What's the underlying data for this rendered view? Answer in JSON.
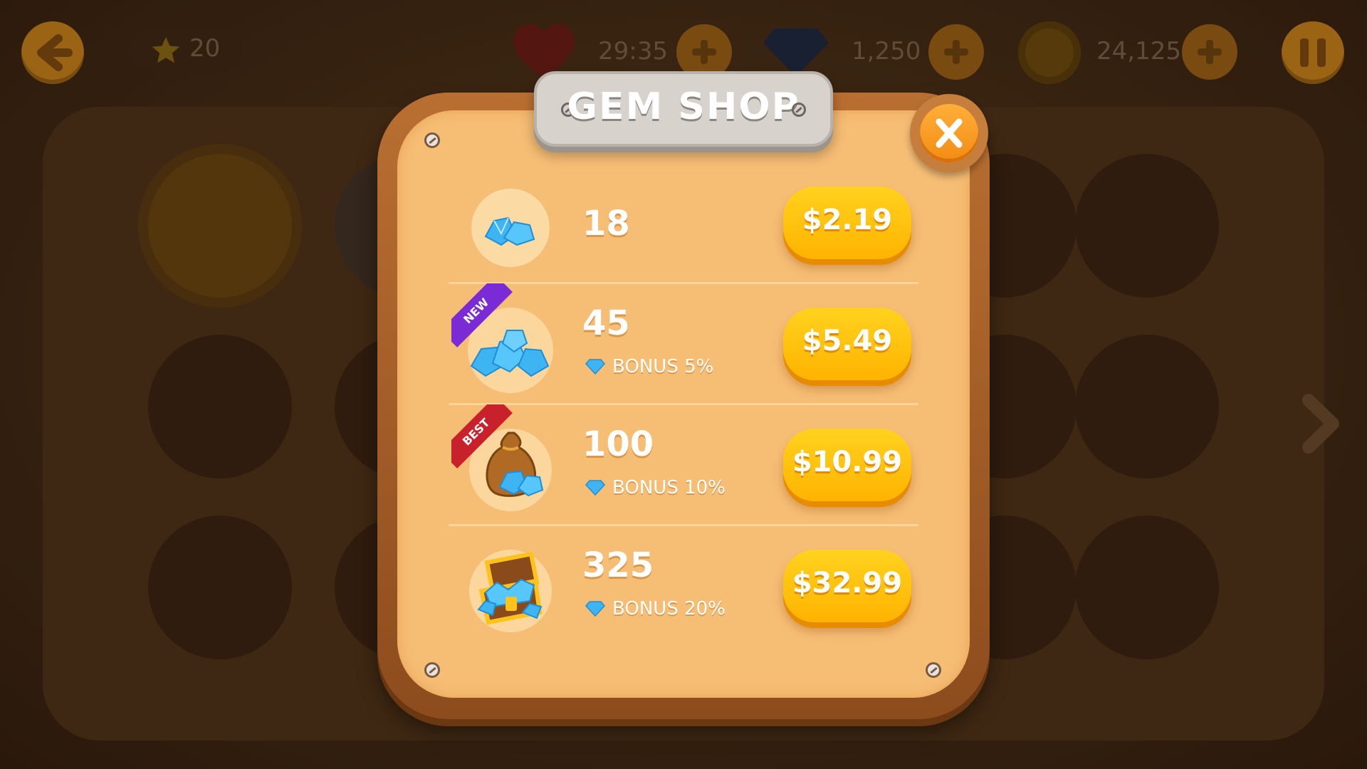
{
  "hud": {
    "stars": "20",
    "timer": "29:35",
    "gems": "1,250",
    "coins": "24,125"
  },
  "shop": {
    "title": "GEM SHOP",
    "packs": [
      {
        "amount": "18",
        "bonus": "",
        "price": "$2.19",
        "badge": "",
        "icon": "small-gem-pile-icon"
      },
      {
        "amount": "45",
        "bonus": "BONUS 5%",
        "price": "$5.49",
        "badge": "NEW",
        "icon": "gem-pile-icon"
      },
      {
        "amount": "100",
        "bonus": "BONUS 10%",
        "price": "$10.99",
        "badge": "BEST",
        "icon": "gem-sack-icon"
      },
      {
        "amount": "325",
        "bonus": "BONUS 20%",
        "price": "$32.99",
        "badge": "",
        "icon": "treasure-chest-icon"
      }
    ]
  },
  "colors": {
    "panel": "#f6bd75",
    "frame": "#a65e27",
    "button": "#ffc20e",
    "gem": "#3fb4f2",
    "badge_new": "#7a2bd6",
    "badge_best": "#c8212b"
  }
}
